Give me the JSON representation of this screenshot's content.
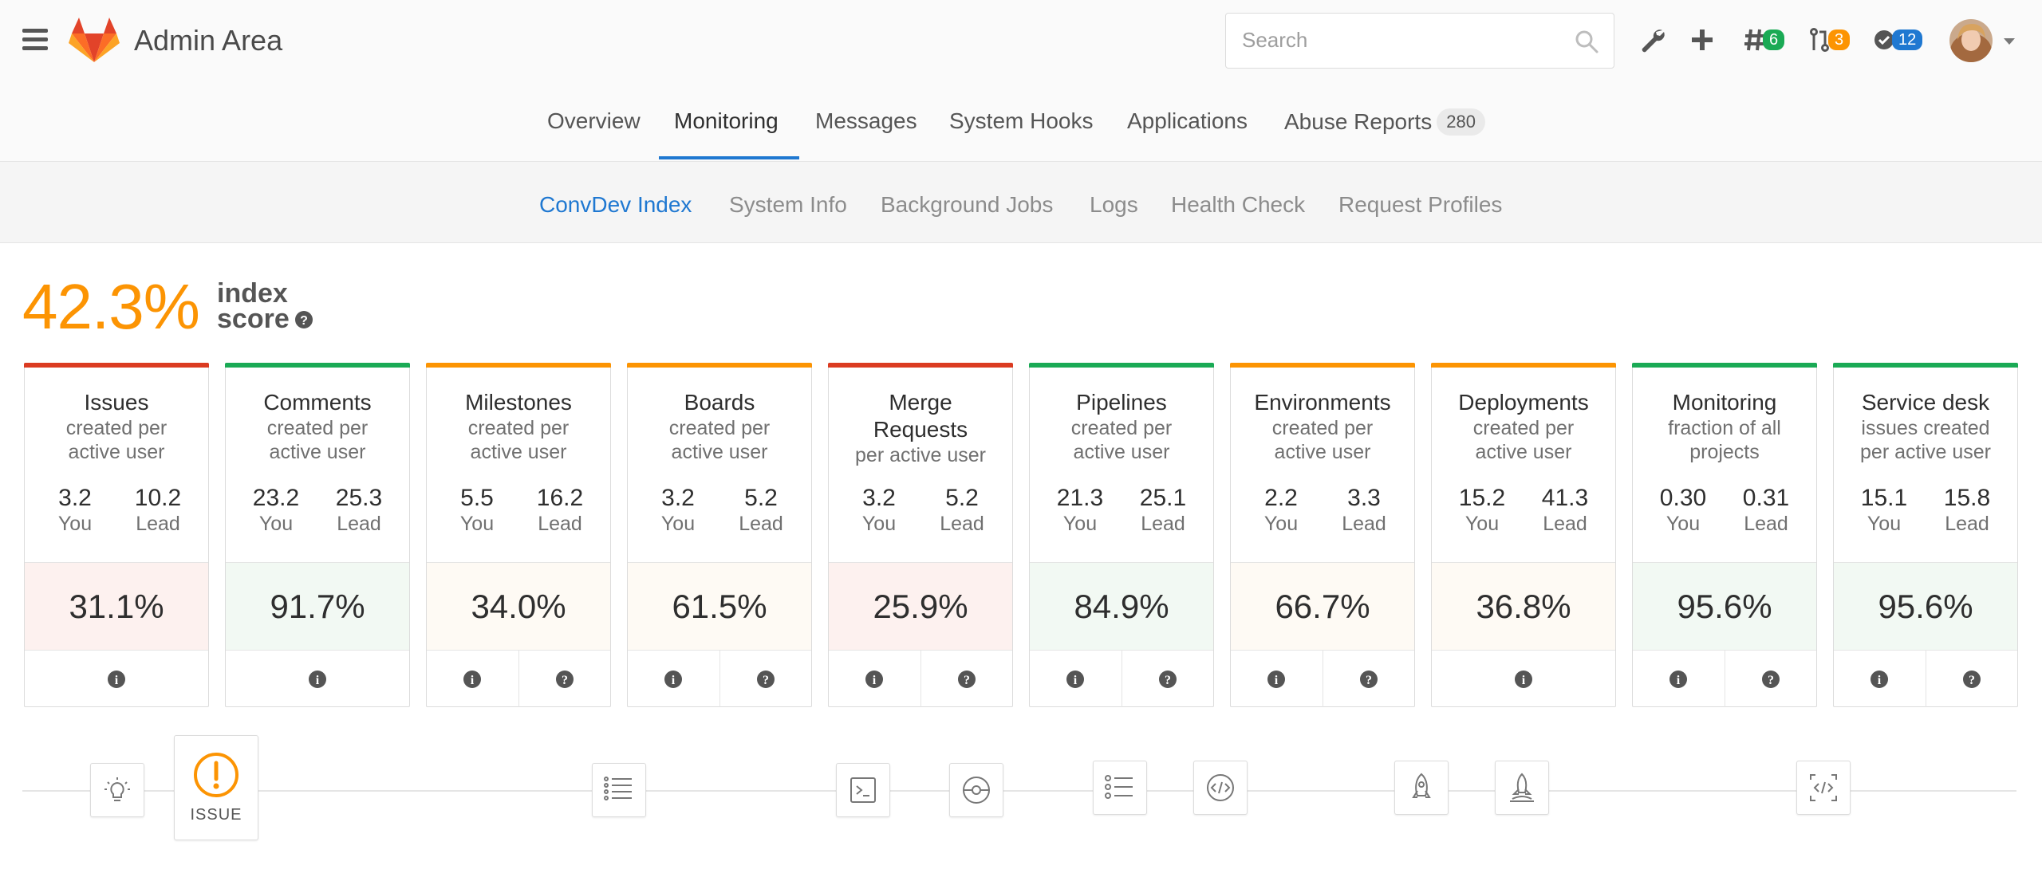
{
  "header": {
    "title": "Admin Area",
    "search_placeholder": "Search",
    "todos_count": "6",
    "merge_requests_count": "3",
    "issues_count": "12",
    "colors": {
      "todos": "#1aaa55",
      "merge_requests": "#fc9403",
      "issues": "#1f78d1"
    }
  },
  "nav": {
    "tabs": [
      {
        "label": "Overview"
      },
      {
        "label": "Monitoring",
        "active": true
      },
      {
        "label": "Messages"
      },
      {
        "label": "System Hooks"
      },
      {
        "label": "Applications"
      },
      {
        "label": "Abuse Reports",
        "count": "280"
      }
    ]
  },
  "subnav": {
    "tabs": [
      {
        "label": "ConvDev Index",
        "active": true
      },
      {
        "label": "System Info"
      },
      {
        "label": "Background Jobs"
      },
      {
        "label": "Logs"
      },
      {
        "label": "Health Check"
      },
      {
        "label": "Request Profiles"
      }
    ]
  },
  "score": {
    "value": "42.3%",
    "label_line1": "index",
    "label_line2": "score"
  },
  "labels": {
    "you": "You",
    "lead": "Lead"
  },
  "cards": [
    {
      "title": "Issues",
      "desc1": "created per",
      "desc2": "active user",
      "you": "3.2",
      "lead": "10.2",
      "pct": "31.1%",
      "status": "red"
    },
    {
      "title": "Comments",
      "desc1": "created per",
      "desc2": "active user",
      "you": "23.2",
      "lead": "25.3",
      "pct": "91.7%",
      "status": "green"
    },
    {
      "title": "Milestones",
      "desc1": "created per",
      "desc2": "active user",
      "you": "5.5",
      "lead": "16.2",
      "pct": "34.0%",
      "status": "orange"
    },
    {
      "title": "Boards",
      "desc1": "created per",
      "desc2": "active user",
      "you": "3.2",
      "lead": "5.2",
      "pct": "61.5%",
      "status": "orange"
    },
    {
      "title": "Merge",
      "title2": "Requests",
      "desc1": "per active user",
      "desc2": "",
      "you": "3.2",
      "lead": "5.2",
      "pct": "25.9%",
      "status": "red"
    },
    {
      "title": "Pipelines",
      "desc1": "created per",
      "desc2": "active user",
      "you": "21.3",
      "lead": "25.1",
      "pct": "84.9%",
      "status": "green"
    },
    {
      "title": "Environments",
      "desc1": "created per",
      "desc2": "active user",
      "you": "2.2",
      "lead": "3.3",
      "pct": "66.7%",
      "status": "orange"
    },
    {
      "title": "Deployments",
      "desc1": "created per",
      "desc2": "active user",
      "you": "15.2",
      "lead": "41.3",
      "pct": "36.8%",
      "status": "orange"
    },
    {
      "title": "Monitoring",
      "desc1": "fraction of all",
      "desc2": "projects",
      "you": "0.30",
      "lead": "0.31",
      "pct": "95.6%",
      "status": "green"
    },
    {
      "title": "Service desk",
      "desc1": "issues created",
      "desc2": "per active user",
      "you": "15.1",
      "lead": "15.8",
      "pct": "95.6%",
      "status": "green"
    }
  ],
  "status_colors": {
    "red": {
      "bar": "#db3b21",
      "bg": "#fdf1ef"
    },
    "green": {
      "bar": "#1aaa55",
      "bg": "#f2f9f3"
    },
    "orange": {
      "bar": "#fc9403",
      "bg": "#fefaf4"
    }
  },
  "timeline": {
    "issue_label": "ISSUE"
  },
  "accent": "#fc9403"
}
